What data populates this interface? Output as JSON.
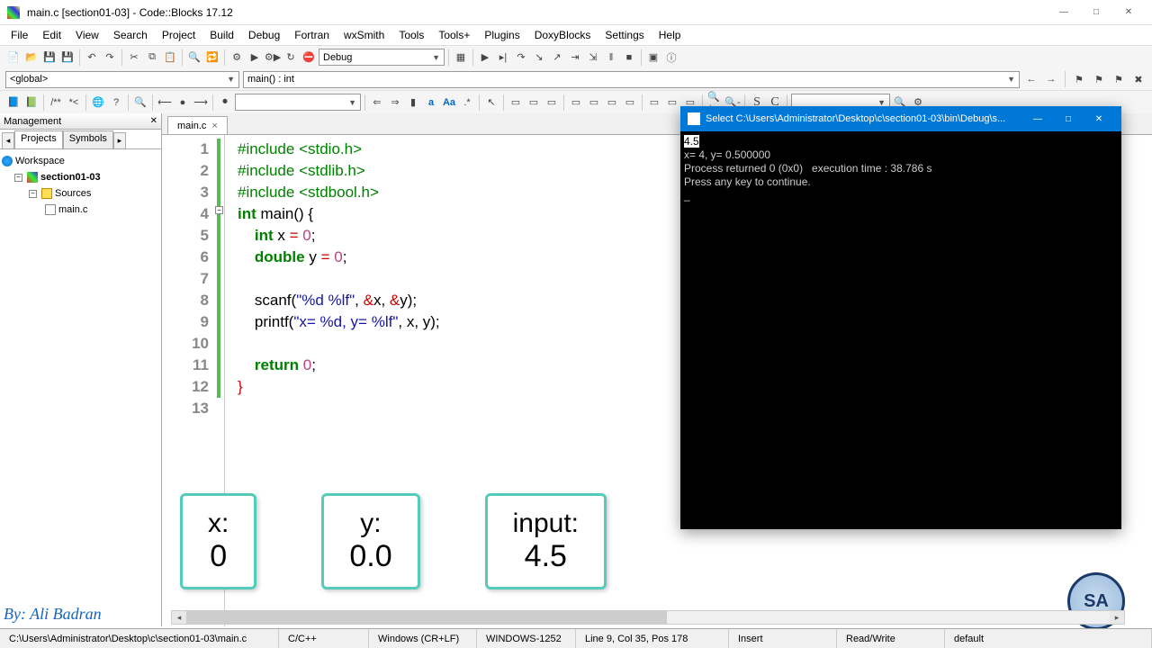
{
  "window": {
    "title": "main.c [section01-03] - Code::Blocks 17.12"
  },
  "menu": [
    "File",
    "Edit",
    "View",
    "Search",
    "Project",
    "Build",
    "Debug",
    "Fortran",
    "wxSmith",
    "Tools",
    "Tools+",
    "Plugins",
    "DoxyBlocks",
    "Settings",
    "Help"
  ],
  "scope_combo": "<global>",
  "func_combo": "main() : int",
  "build_target": "Debug",
  "mgmt": {
    "title": "Management",
    "tabs": {
      "active": "Projects",
      "other": "Symbols"
    },
    "workspace": "Workspace",
    "project": "section01-03",
    "folder": "Sources",
    "file": "main.c"
  },
  "file_tab": "main.c",
  "code": {
    "l1a": "#include ",
    "l1b": "<stdio.h>",
    "l2a": "#include ",
    "l2b": "<stdlib.h>",
    "l3a": "#include ",
    "l3b": "<stdbool.h>",
    "l4a": "int",
    "l4b": " main() {",
    "l5a": "    int",
    "l5b": " x ",
    "l5c": "=",
    "l5d": " 0",
    "l5e": ";",
    "l6a": "    double",
    "l6b": " y ",
    "l6c": "=",
    "l6d": " 0",
    "l6e": ";",
    "l8a": "    scanf(",
    "l8b": "\"%d %lf\"",
    "l8c": ", ",
    "l8d": "&",
    "l8e": "x, ",
    "l8f": "&",
    "l8g": "y);",
    "l9a": "    printf(",
    "l9b": "\"x= %d, y= %lf\"",
    "l9c": ", x, y);",
    "l11a": "    return ",
    "l11b": "0",
    "l11c": ";",
    "l12": "}"
  },
  "line_numbers": [
    "1",
    "2",
    "3",
    "4",
    "5",
    "6",
    "7",
    "8",
    "9",
    "10",
    "11",
    "12",
    "13"
  ],
  "console": {
    "title": "Select C:\\Users\\Administrator\\Desktop\\c\\section01-03\\bin\\Debug\\s...",
    "l1": "4.5",
    "l2": "x= 4, y= 0.500000",
    "l3": "Process returned 0 (0x0)   execution time : 38.786 s",
    "l4": "Press any key to continue.",
    "cursor": "_"
  },
  "overlay": {
    "x_label": "x:",
    "x_val": "0",
    "y_label": "y:",
    "y_val": "0.0",
    "in_label": "input:",
    "in_val": "4.5"
  },
  "credit": "By: Ali Badran",
  "status": {
    "path": "C:\\Users\\Administrator\\Desktop\\c\\section01-03\\main.c",
    "lang": "C/C++",
    "eol": "Windows (CR+LF)",
    "enc": "WINDOWS-1252",
    "pos": "Line 9, Col 35, Pos 178",
    "ins": "Insert",
    "rw": "Read/Write",
    "scheme": "default"
  }
}
